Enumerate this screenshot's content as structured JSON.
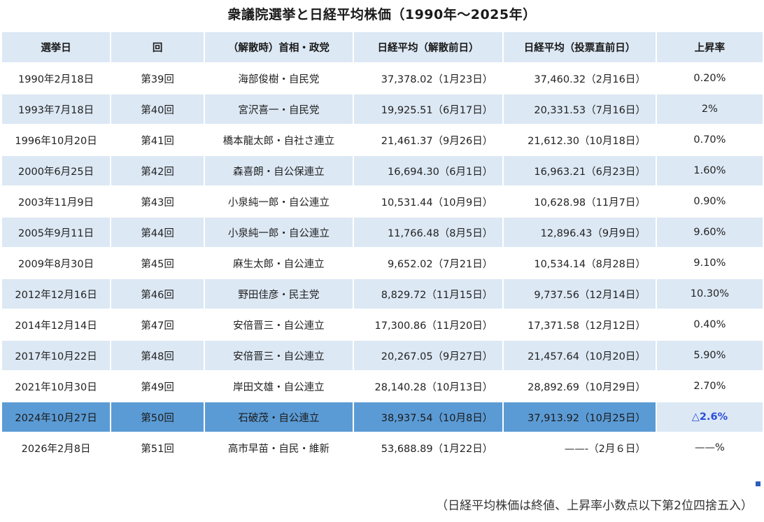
{
  "title": "衆議院選挙と日経平均株価（1990年〜2025年）",
  "headers": [
    "選挙日",
    "回",
    "（解散時）首相・政党",
    "日経平均（解散前日）",
    "日経平均（投票直前日）",
    "上昇率"
  ],
  "rows": [
    {
      "date": "1990年2月18日",
      "session": "第39回",
      "pm": "海部俊樹・自民党",
      "before_dissolution": "37,378.02（1月23日）",
      "before_vote": "37,460.32（2月16日）",
      "rate": "0.20%"
    },
    {
      "date": "1993年7月18日",
      "session": "第40回",
      "pm": "宮沢喜一・自民党",
      "before_dissolution": "19,925.51（6月17日）",
      "before_vote": "20,331.53（7月16日）",
      "rate": "2%"
    },
    {
      "date": "1996年10月20日",
      "session": "第41回",
      "pm": "橋本龍太郎・自社さ連立",
      "before_dissolution": "21,461.37（9月26日）",
      "before_vote": "21,612.30（10月18日）",
      "rate": "0.70%"
    },
    {
      "date": "2000年6月25日",
      "session": "第42回",
      "pm": "森喜朗・自公保連立",
      "before_dissolution": "16,694.30（6月1日）",
      "before_vote": "16,963.21（6月23日）",
      "rate": "1.60%"
    },
    {
      "date": "2003年11月9日",
      "session": "第43回",
      "pm": "小泉純一郎・自公連立",
      "before_dissolution": "10,531.44（10月9日）",
      "before_vote": "10,628.98（11月7日）",
      "rate": "0.90%"
    },
    {
      "date": "2005年9月11日",
      "session": "第44回",
      "pm": "小泉純一郎・自公連立",
      "before_dissolution": "11,766.48（8月5日）",
      "before_vote": "12,896.43（9月9日）",
      "rate": "9.60%"
    },
    {
      "date": "2009年8月30日",
      "session": "第45回",
      "pm": "麻生太郎・自公連立",
      "before_dissolution": "9,652.02（7月21日）",
      "before_vote": "10,534.14（8月28日）",
      "rate": "9.10%"
    },
    {
      "date": "2012年12月16日",
      "session": "第46回",
      "pm": "野田佳彦・民主党",
      "before_dissolution": "8,829.72（11月15日）",
      "before_vote": "9,737.56（12月14日）",
      "rate": "10.30%"
    },
    {
      "date": "2014年12月14日",
      "session": "第47回",
      "pm": "安倍晋三・自公連立",
      "before_dissolution": "17,300.86（11月20日）",
      "before_vote": "17,371.58（12月12日）",
      "rate": "0.40%"
    },
    {
      "date": "2017年10月22日",
      "session": "第48回",
      "pm": "安倍晋三・自公連立",
      "before_dissolution": "20,267.05（9月27日）",
      "before_vote": "21,457.64（10月20日）",
      "rate": "5.90%"
    },
    {
      "date": "2021年10月30日",
      "session": "第49回",
      "pm": "岸田文雄・自公連立",
      "before_dissolution": "28,140.28（10月13日）",
      "before_vote": "28,892.69（10月29日）",
      "rate": "2.70%"
    },
    {
      "date": "2024年10月27日",
      "session": "第50回",
      "pm": "石破茂・自公連立",
      "before_dissolution": "38,937.54（10月8日）",
      "before_vote": "37,913.92（10月25日）",
      "rate": "△2.6%",
      "highlight": true,
      "negative": true
    },
    {
      "date": "2026年2月8日",
      "session": "第51回",
      "pm": "高市早苗・自民・維新",
      "before_dissolution": "53,688.89（1月22日）",
      "before_vote": "——-（2月６日）",
      "rate": "——%"
    }
  ],
  "footnote": "（日経平均株価は終値、上昇率小数点以下第2位四捨五入）",
  "colors": {
    "header_bg": "#dce8f4",
    "stripe_bg": "#dce8f4",
    "highlight_bg": "#5b9bd5",
    "negative_text": "#2b4cdb"
  }
}
